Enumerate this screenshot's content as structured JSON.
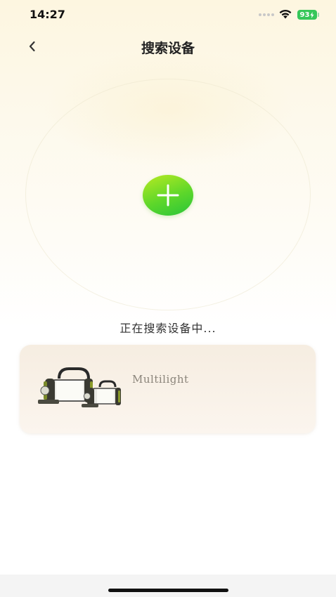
{
  "status_bar": {
    "time": "14:27",
    "battery": "93"
  },
  "nav": {
    "title": "搜索设备",
    "back_icon": "chevron-left-icon"
  },
  "search": {
    "add_icon": "plus-icon",
    "status_text": "正在搜索设备中..."
  },
  "devices": [
    {
      "name": "Multilight",
      "image": "lantern-flashlight-product"
    }
  ],
  "colors": {
    "accent_green": "#5ed72a",
    "accent_lime": "#b8ea22",
    "battery_green": "#35c759",
    "card_bg": "#f6ede1"
  }
}
